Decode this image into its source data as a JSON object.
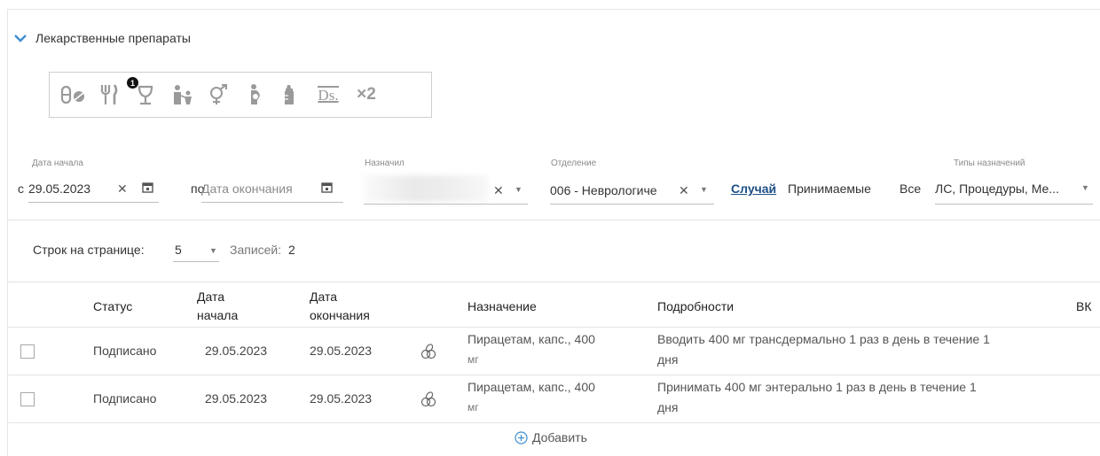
{
  "section": {
    "title": "Лекарственные препараты",
    "expand_icon": "chevron-down-icon"
  },
  "toolbar": {
    "icons": [
      "pills-icon",
      "cutlery-icon",
      "wine-glass-icon",
      "family-icon",
      "gender-icon",
      "pregnancy-icon",
      "baby-bottle-icon",
      "ds-icon",
      "multiply-icon"
    ],
    "badge": "1",
    "ds_label": "Ds.",
    "x2_label": "×2"
  },
  "filters": {
    "start_date": {
      "label": "Дата начала",
      "prefix": "с",
      "value": "29.05.2023"
    },
    "end_date": {
      "prefix": "по",
      "placeholder": "Дата окончания"
    },
    "assigned": {
      "label": "Назначил",
      "value": ""
    },
    "department": {
      "label": "Отделение",
      "value": "006 - Неврологиче"
    },
    "mode_links": {
      "case": "Случай",
      "taken": "Принимаемые",
      "all": "Все"
    },
    "types": {
      "label": "Типы назначений",
      "value": "ЛС, Процедуры, Ме..."
    }
  },
  "pagination": {
    "rows_label": "Строк на странице:",
    "rows_value": "5",
    "records_label": "Записей:",
    "records_value": "2"
  },
  "table": {
    "headers": {
      "status": "Статус",
      "start_l1": "Дата",
      "start_l2": "начала",
      "end_l1": "Дата",
      "end_l2": "окончания",
      "purpose": "Назначение",
      "details": "Подробности",
      "vk": "ВК"
    },
    "rows": [
      {
        "status": "Подписано",
        "start": "29.05.2023",
        "end": "29.05.2023",
        "purpose_l1": "Пирацетам, капс., 400",
        "purpose_l2": "мг",
        "details_l1": "Вводить 400 мг трансдермально 1 раз в день в течение 1",
        "details_l2": "дня"
      },
      {
        "status": "Подписано",
        "start": "29.05.2023",
        "end": "29.05.2023",
        "purpose_l1": "Пирацетам, капс., 400",
        "purpose_l2": "мг",
        "details_l1": "Принимать 400 мг энтерально 1 раз в день в течение 1",
        "details_l2": "дня"
      }
    ],
    "add_label": "Добавить"
  }
}
